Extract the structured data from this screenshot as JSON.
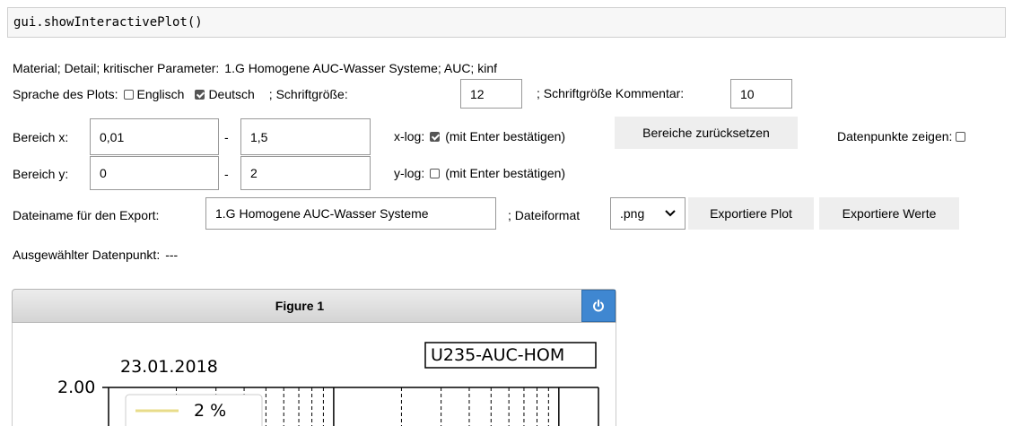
{
  "code": "gui.showInteractivePlot()",
  "info": {
    "label": "Material; Detail; kritischer Parameter:",
    "value": "1.G Homogene AUC-Wasser Systeme; AUC; kinf"
  },
  "language": {
    "label": "Sprache des Plots:",
    "english_label": "Englisch",
    "english_checked": false,
    "german_label": "Deutsch",
    "german_checked": true,
    "fontsize_label": "; Schriftgröße:",
    "fontsize_value": "12",
    "comment_fontsize_label": "; Schriftgröße Kommentar:",
    "comment_fontsize_value": "10"
  },
  "range_x": {
    "label": "Bereich x:",
    "min": "0,01",
    "dash": "-",
    "max": "1,5",
    "log_label": "x-log:",
    "log_checked": true,
    "hint": "(mit Enter bestätigen)",
    "reset_button": "Bereiche zurücksetzen",
    "show_points_label": "Datenpunkte zeigen:",
    "show_points_checked": false
  },
  "range_y": {
    "label": "Bereich y:",
    "min": "0",
    "dash": "-",
    "max": "2",
    "log_label": "y-log:",
    "log_checked": false,
    "hint": "(mit Enter bestätigen)"
  },
  "export": {
    "filename_label": "Dateiname für den Export:",
    "filename_value": "1.G Homogene AUC-Wasser Systeme",
    "format_label": "; Dateiformat",
    "format_value": ".png",
    "export_plot_button": "Exportiere Plot",
    "export_values_button": "Exportiere Werte"
  },
  "selected_point": {
    "label": "Ausgewählter Datenpunkt:",
    "value": "---"
  },
  "figure": {
    "title": "Figure 1",
    "power_icon": "power-icon",
    "date": "23.01.2018",
    "tag": "U235-AUC-HOM",
    "y_tick_top": "2.00",
    "legend_label": "2 %",
    "legend_color": "#e8dc8a"
  },
  "chart_data": {
    "type": "line",
    "ylim": [
      0,
      2
    ],
    "xlim": [
      0.01,
      1.5
    ],
    "x_scale": "log",
    "y_ticks": [
      "2.00"
    ],
    "series": [
      {
        "name": "2 %",
        "color": "#e8dc8a"
      }
    ],
    "annotations": [
      "23.01.2018",
      "U235-AUC-HOM"
    ]
  }
}
